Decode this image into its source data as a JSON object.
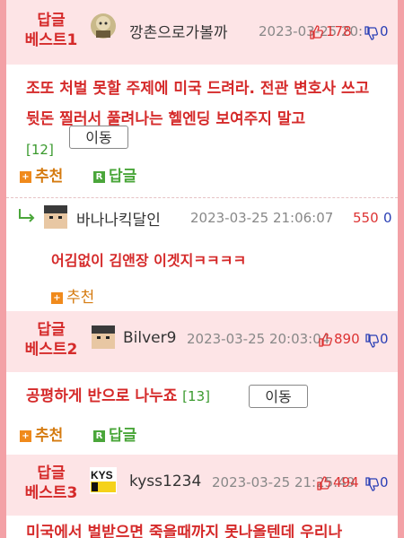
{
  "posts": [
    {
      "rank": "답글\n베스트1",
      "nick": "깡촌으로가볼까",
      "date": "2023-03-25 20:",
      "up": "178",
      "down": "0",
      "content": "조또 처벌 못할 주제에 미국 드려라. 전관 변호사 쓰고 뒷돈 찔러서 풀려나는 헬엔딩 보여주지 말고",
      "count": "[12]",
      "move_label": "이동",
      "recommend_label": "추천",
      "reply_label": "답글",
      "reply": {
        "nick": "바나나킥달인",
        "date": "2023-03-25 21:06:07",
        "up": "550",
        "down": "0",
        "content": "어김없이 김앤장 이겟지ㅋㅋㅋㅋ",
        "recommend_label": "추천"
      }
    },
    {
      "rank": "답글\n베스트2",
      "nick": "Bilver9",
      "date": "2023-03-25 20:03:04",
      "up": "890",
      "down": "0",
      "content": "공평하게 반으로 나누죠",
      "count": "[13]",
      "move_label": "이동",
      "recommend_label": "추천",
      "reply_label": "답글"
    },
    {
      "rank": "답글\n베스트3",
      "nick": "kyss1234",
      "date": "2023-03-25 21:25:49",
      "up": "494",
      "down": "0",
      "content": "미국에서 벌받으면 죽을때까지 못나올텐데 우리나"
    }
  ],
  "colors": {
    "frame": "#f3a1a6",
    "header_bg": "#fde4e6",
    "accent": "#d52a2a",
    "count_green": "#3a9a2e",
    "down_blue": "#2a3fb5",
    "recommend_orange": "#d57b10",
    "reply_green": "#4aa63a"
  }
}
